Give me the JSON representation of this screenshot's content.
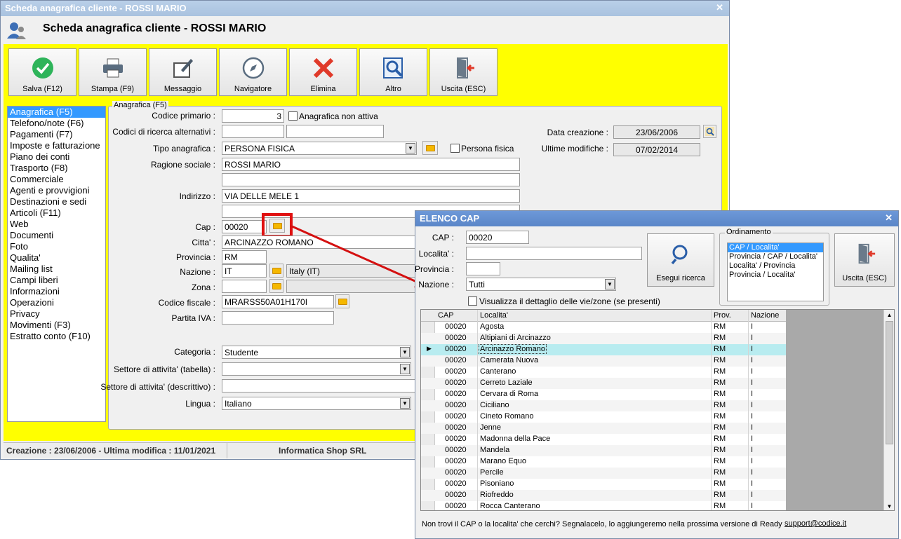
{
  "main": {
    "title": "Scheda anagrafica cliente - ROSSI MARIO",
    "header_title": "Scheda anagrafica cliente - ROSSI MARIO",
    "toolbar": [
      {
        "label": "Salva (F12)",
        "icon": "check-icon"
      },
      {
        "label": "Stampa (F9)",
        "icon": "printer-icon"
      },
      {
        "label": "Messaggio",
        "icon": "message-icon"
      },
      {
        "label": "Navigatore",
        "icon": "compass-icon"
      },
      {
        "label": "Elimina",
        "icon": "delete-icon"
      },
      {
        "label": "Altro",
        "icon": "search-doc-icon"
      },
      {
        "label": "Uscita (ESC)",
        "icon": "exit-icon"
      }
    ],
    "nav": [
      "Anagrafica (F5)",
      "Telefono/note (F6)",
      "Pagamenti (F7)",
      "Imposte e fatturazione",
      "Piano dei conti",
      "Trasporto (F8)",
      "Commerciale",
      "Agenti e provvigioni",
      "Destinazioni e sedi",
      "Articoli (F11)",
      "Web",
      "Documenti",
      "Foto",
      "Qualita'",
      "Mailing list",
      "Campi liberi",
      "Informazioni",
      "Operazioni",
      "Privacy",
      "Movimenti (F3)",
      "Estratto conto (F10)"
    ],
    "group_title": "Anagrafica (F5)",
    "labels": {
      "codice_primario": "Codice primario :",
      "codici_ricerca": "Codici di ricerca alternativi :",
      "tipo": "Tipo anagrafica :",
      "ragione": "Ragione sociale :",
      "indirizzo": "Indirizzo :",
      "cap": "Cap :",
      "citta": "Citta' :",
      "provincia": "Provincia :",
      "nazione": "Nazione :",
      "zona": "Zona :",
      "cf": "Codice fiscale :",
      "piva": "Partita IVA :",
      "categoria": "Categoria :",
      "settore_tab": "Settore di attivita' (tabella) :",
      "settore_desc": "Settore di attivita' (descrittivo) :",
      "lingua": "Lingua :",
      "data_creazione": "Data creazione :",
      "ultime_modifiche": "Ultime modifiche :",
      "non_attiva": "Anagrafica non attiva",
      "persona_fisica": "Persona fisica"
    },
    "values": {
      "codice_primario": "3",
      "tipo": "PERSONA FISICA",
      "ragione": "ROSSI MARIO",
      "indirizzo": "VIA DELLE MELE 1",
      "cap": "00020",
      "citta": "ARCINAZZO ROMANO",
      "provincia": "RM",
      "nazione": "IT",
      "nazione_desc": "Italy (IT)",
      "cf": "MRARSS50A01H170I",
      "categoria": "Studente",
      "lingua": "Italiano",
      "data_creazione": "23/06/2006",
      "ultime_modifiche": "07/02/2014"
    },
    "status": {
      "left": "Creazione : 23/06/2006 - Ultima modifica : 11/01/2021",
      "center": "Informatica Shop SRL"
    }
  },
  "popup": {
    "title": "ELENCO CAP",
    "labels": {
      "cap": "CAP :",
      "localita": "Localita' :",
      "provincia": "Provincia :",
      "nazione": "Nazione :"
    },
    "values": {
      "cap": "00020",
      "nazione": "Tutti"
    },
    "search_button": "Esegui ricerca",
    "exit_button": "Uscita (ESC)",
    "ordinamento_title": "Ordinamento",
    "ordinamento": [
      "CAP / Localita'",
      "Provincia / CAP / Localita'",
      "Localita' / Provincia",
      "Provincia / Localita'"
    ],
    "dettaglio_label": "Visualizza il dettaglio delle vie/zone (se presenti)",
    "columns": [
      "CAP",
      "Localita'",
      "Prov.",
      "Nazione"
    ],
    "rows": [
      [
        "00020",
        "Agosta",
        "RM",
        "I"
      ],
      [
        "00020",
        "Altipiani di Arcinazzo",
        "RM",
        "I"
      ],
      [
        "00020",
        "Arcinazzo Romano",
        "RM",
        "I"
      ],
      [
        "00020",
        "Camerata Nuova",
        "RM",
        "I"
      ],
      [
        "00020",
        "Canterano",
        "RM",
        "I"
      ],
      [
        "00020",
        "Cerreto Laziale",
        "RM",
        "I"
      ],
      [
        "00020",
        "Cervara di Roma",
        "RM",
        "I"
      ],
      [
        "00020",
        "Ciciliano",
        "RM",
        "I"
      ],
      [
        "00020",
        "Cineto Romano",
        "RM",
        "I"
      ],
      [
        "00020",
        "Jenne",
        "RM",
        "I"
      ],
      [
        "00020",
        "Madonna della Pace",
        "RM",
        "I"
      ],
      [
        "00020",
        "Mandela",
        "RM",
        "I"
      ],
      [
        "00020",
        "Marano Equo",
        "RM",
        "I"
      ],
      [
        "00020",
        "Percile",
        "RM",
        "I"
      ],
      [
        "00020",
        "Pisoniano",
        "RM",
        "I"
      ],
      [
        "00020",
        "Riofreddo",
        "RM",
        "I"
      ],
      [
        "00020",
        "Rocca Canterano",
        "RM",
        "I"
      ]
    ],
    "footer_text": "Non trovi il CAP o la localita' che cerchi? Segnalacelo, lo aggiungeremo nella prossima versione di Ready",
    "footer_link": "support@codice.it"
  }
}
